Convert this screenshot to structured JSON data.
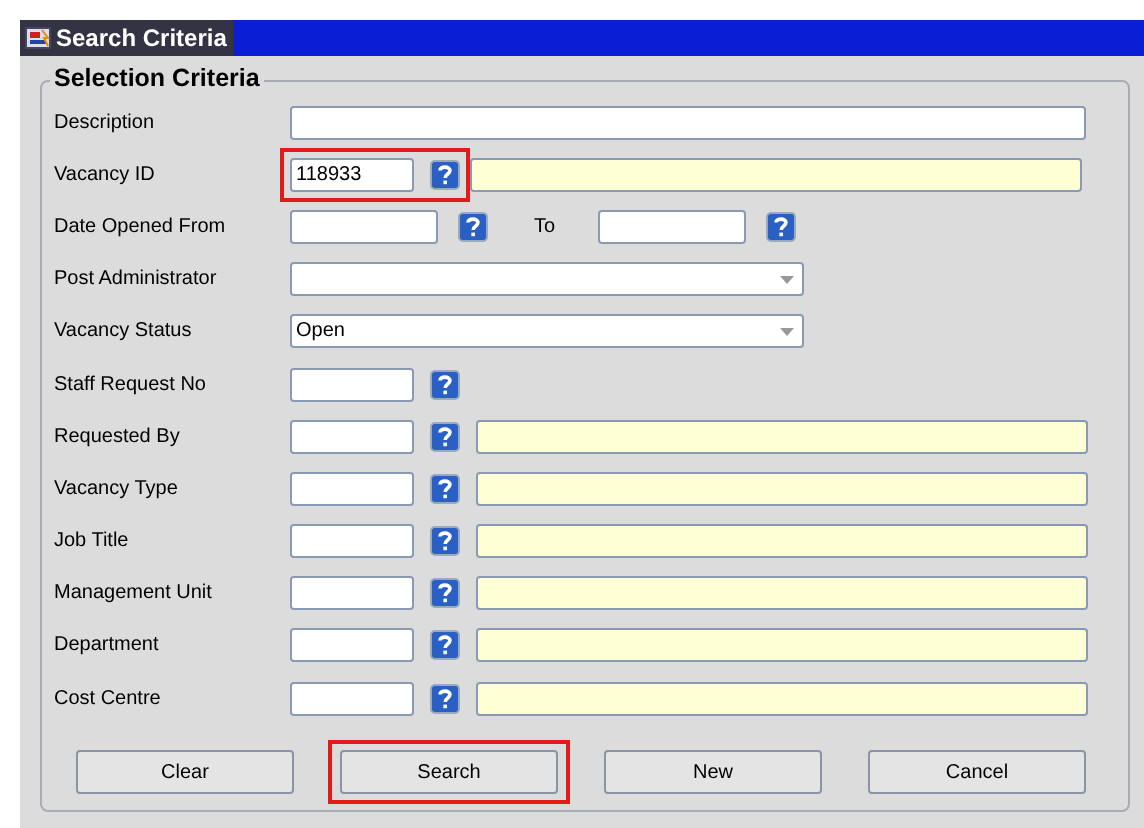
{
  "window": {
    "title": "Search Criteria"
  },
  "group": {
    "title": "Selection Criteria"
  },
  "rows": [
    {
      "kind": "text",
      "label": "Description"
    },
    {
      "kind": "lov",
      "label": "Vacancy ID",
      "value": "118933",
      "highlighted": true
    },
    {
      "kind": "date_range",
      "label": "Date Opened From",
      "to_label": "To"
    },
    {
      "kind": "select",
      "label": "Post Administrator"
    },
    {
      "kind": "select",
      "label": "Vacancy Status",
      "value": "Open"
    },
    {
      "kind": "short_lov",
      "label": "Staff Request No"
    },
    {
      "kind": "lov",
      "label": "Requested By",
      "highlighted": false
    },
    {
      "kind": "lov",
      "label": "Vacancy Type",
      "highlighted": false
    },
    {
      "kind": "lov",
      "label": "Job Title",
      "highlighted": false
    },
    {
      "kind": "lov",
      "label": "Management Unit",
      "highlighted": false
    },
    {
      "kind": "lov",
      "label": "Department",
      "highlighted": false
    },
    {
      "kind": "lov",
      "label": "Cost Centre",
      "highlighted": false
    }
  ],
  "buttons": [
    {
      "label": "Clear",
      "highlighted": false
    },
    {
      "label": "Search",
      "highlighted": true
    },
    {
      "label": "New",
      "highlighted": false
    },
    {
      "label": "Cancel",
      "highlighted": false
    }
  ]
}
